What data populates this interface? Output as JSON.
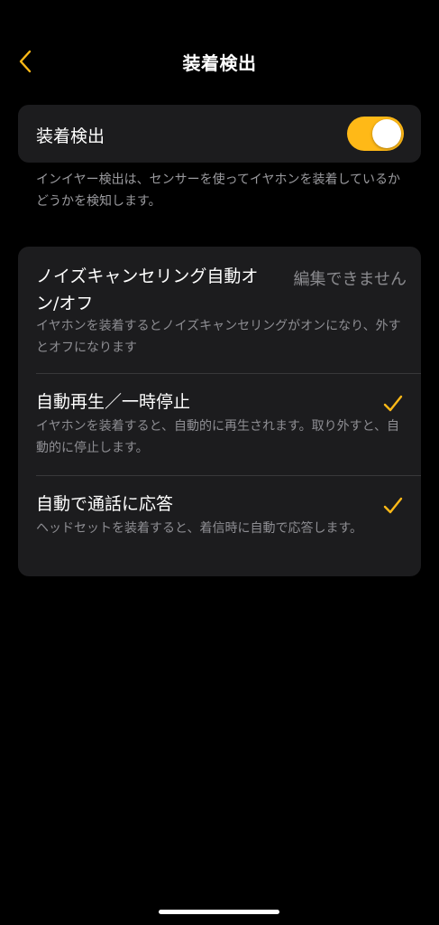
{
  "nav": {
    "title": "装着検出",
    "back_icon": "chevron-left-icon"
  },
  "colors": {
    "accent": "#ffb917",
    "card_bg": "#1c1c1e",
    "secondary_text": "#8e8e93"
  },
  "wear_detection": {
    "label": "装着検出",
    "enabled": true,
    "footnote": "インイヤー検出は、センサーを使ってイヤホンを装着しているかどうかを検知します。"
  },
  "options": [
    {
      "title": "ノイズキャンセリング自動オン/オフ",
      "status": "編集できません",
      "description": "イヤホンを装着するとノイズキャンセリングがオンになり、外すとオフになります"
    },
    {
      "title": "自動再生／一時停止",
      "checked": true,
      "description": "イヤホンを装着すると、自動的に再生されます。取り外すと、自動的に停止します。"
    },
    {
      "title": "自動で通話に応答",
      "checked": true,
      "description": "ヘッドセットを装着すると、着信時に自動で応答します。"
    }
  ]
}
